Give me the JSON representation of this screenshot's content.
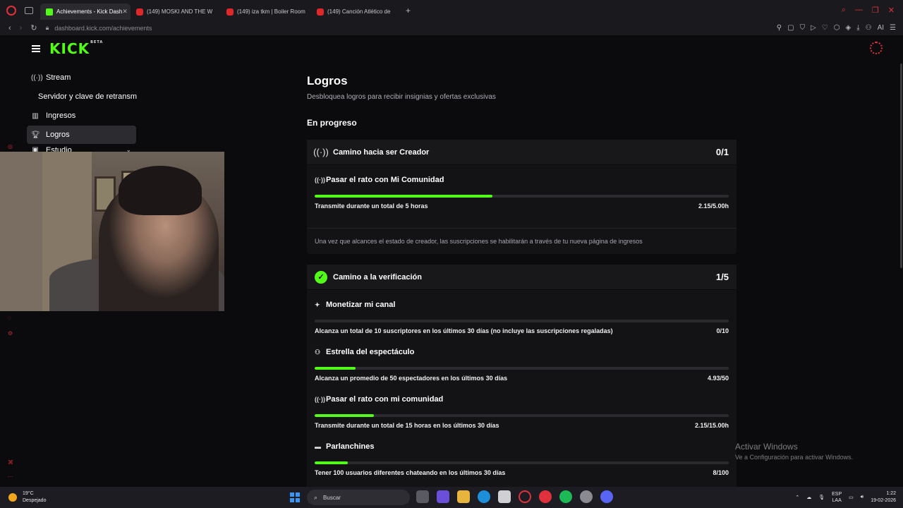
{
  "browser": {
    "tabs": [
      {
        "label": "Achievements - Kick Dash",
        "favicon": "kick",
        "active": true
      },
      {
        "label": "(149) MOSKI AND THE W",
        "favicon": "youtube",
        "active": false
      },
      {
        "label": "(149) iza tkm | Boiler Room",
        "favicon": "youtube",
        "active": false
      },
      {
        "label": "(149) Canción Atlético de",
        "favicon": "youtube",
        "active": false
      }
    ],
    "url_domain": "dashboard.kick.com",
    "url_path": "/achievements",
    "ai_label": "AI"
  },
  "brand": {
    "logo": "KICK",
    "beta": "BETA",
    "accent": "#53fc18"
  },
  "sidebar": {
    "items": [
      {
        "label": "Stream",
        "icon": "broadcast-icon"
      },
      {
        "label": "Servidor y clave de retransm",
        "icon": ""
      },
      {
        "label": "Ingresos",
        "icon": "chart-icon"
      },
      {
        "label": "Logros",
        "icon": "trophy-icon"
      },
      {
        "label": "Estudio",
        "icon": "studio-icon"
      }
    ]
  },
  "main": {
    "title": "Logros",
    "subtitle": "Desbloquea logros para recibir insignias y ofertas exclusivas",
    "section": "En progreso",
    "cards": [
      {
        "title": "Camino hacia ser Creador",
        "count": "0/1",
        "tasks": [
          {
            "name": "Pasar el rato con Mi Comunidad",
            "desc": "Transmite durante un total de 5 horas",
            "value": "2.15/5.00h",
            "progress": 0.43
          }
        ],
        "note": "Una vez que alcances el estado de creador, las suscripciones se habilitarán a través de tu nueva página de ingresos"
      },
      {
        "title": "Camino a la verificación",
        "count": "1/5",
        "tasks": [
          {
            "name": "Monetizar mi canal",
            "desc": "Alcanza un total de 10 suscriptores en los últimos 30 días (no incluye las suscripciones regaladas)",
            "value": "0/10",
            "progress": 0.0
          },
          {
            "name": "Estrella del espectáculo",
            "desc": "Alcanza un promedio de 50 espectadores en los últimos 30 días",
            "value": "4.93/50",
            "progress": 0.099
          },
          {
            "name": "Pasar el rato con mi comunidad",
            "desc": "Transmite durante un total de 15 horas en los últimos 30 días",
            "value": "2.15/15.00h",
            "progress": 0.143
          },
          {
            "name": "Parlanchines",
            "desc": "Tener 100 usuarios diferentes chateando en los últimos 30 días",
            "value": "8/100",
            "progress": 0.08
          }
        ]
      }
    ]
  },
  "windows_activation": {
    "title": "Activar Windows",
    "subtitle": "Ve a Configuración para activar Windows."
  },
  "taskbar": {
    "temp": "19°C",
    "weather": "Despejado",
    "search_placeholder": "Buscar",
    "lang1": "ESP",
    "lang2": "LAA",
    "time": "1:22",
    "date": "19-02-2026"
  }
}
